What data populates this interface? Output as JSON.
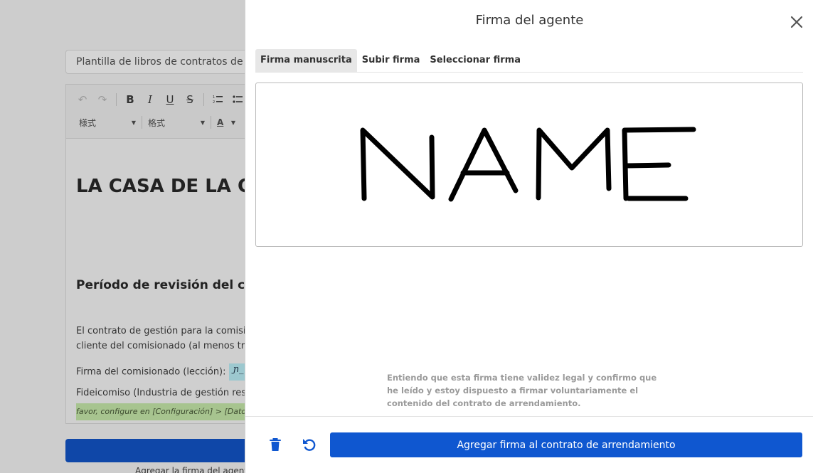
{
  "background": {
    "template_title": "Plantilla de libros de contratos de gestión",
    "toolbar": {
      "undo_icon": "undo-icon",
      "redo_icon": "redo-icon",
      "bold": "B",
      "italic": "I",
      "underline": "U",
      "strike": "S",
      "style_dropdown": "様式",
      "format_dropdown": "格式",
      "font_color": "A"
    },
    "document": {
      "heading": "LA CASA DE LA CASA",
      "section_title": "Período de revisión del contrato",
      "paragraph_line1": "El contrato de gestión para la comisión",
      "paragraph_line2": "cliente del comisionado (al menos tres",
      "signature_label": "Firma del comisionado (lección):",
      "signature_mini": "ɲ_",
      "trust_line": "Fideicomiso (Industria de gestión residencial",
      "config_note": "favor, configure en [Configuración] > [Datos de"
    },
    "under_button_text": "Agregar la firma del agente"
  },
  "modal": {
    "title": "Firma del agente",
    "close_icon": "close-icon",
    "tabs": [
      {
        "label": "Firma manuscrita",
        "active": true
      },
      {
        "label": "Subir firma",
        "active": false
      },
      {
        "label": "Seleccionar firma",
        "active": false
      }
    ],
    "signature_drawn": "NAME",
    "consent_text": "Entiendo que esta firma tiene validez legal y confirmo que he leído y estoy dispuesto a firmar voluntariamente el contenido del contrato de arrendamiento.",
    "footer": {
      "delete_icon": "trash-icon",
      "reset_icon": "undo-icon",
      "primary_label": "Agregar firma al contrato de arrendamiento"
    }
  },
  "colors": {
    "primary": "#0f57d0",
    "overlay_bg": "#cdcdcd",
    "mini_signature_bg": "#9cc8cf",
    "note_bg": "#a7c48f"
  }
}
